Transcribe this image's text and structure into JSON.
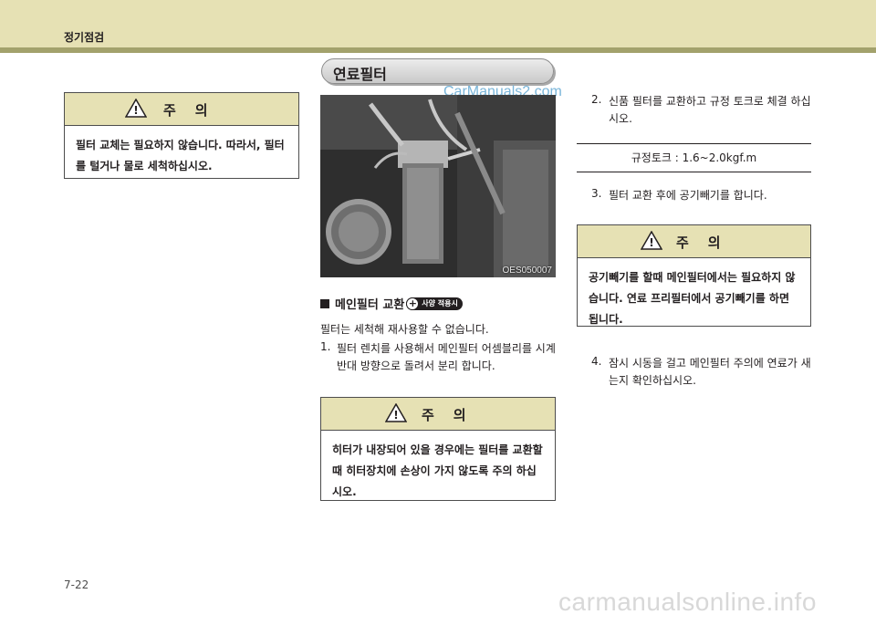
{
  "header": {
    "title": "정기점검"
  },
  "caution_label": "주    의",
  "left_caution": {
    "body": "필터 교체는 필요하지 않습니다. 따라서, 필터를 털거나 물로 세척하십시오."
  },
  "section": {
    "title": "연료필터"
  },
  "watermark": "CarManuals2.com",
  "photo": {
    "code": "OES050007"
  },
  "subsection": {
    "title": "메인필터 교환",
    "badge": "사양 적용시"
  },
  "middle": {
    "intro": "필터는 세척해 재사용할 수 없습니다.",
    "step1_num": "1.",
    "step1_text": "필터 렌치를 사용해서 메인필터 어셈블리를 시계 반대 방향으로 돌려서 분리 합니다."
  },
  "middle_caution": {
    "body": "히터가 내장되어 있을 경우에는 필터를 교환할 때 히터장치에 손상이 가지 않도록 주의 하십시오."
  },
  "right": {
    "step2_num": "2.",
    "step2_text": "신품 필터를 교환하고 규정 토크로 체결 하십시오.",
    "spec": "규정토크 : 1.6~2.0kgf.m",
    "step3_num": "3.",
    "step3_text": "필터 교환 후에 공기빼기를 합니다.",
    "step4_num": "4.",
    "step4_text": "잠시 시동을 걸고 메인필터 주의에 연료가 새는지 확인하십시오."
  },
  "right_caution": {
    "body": "공기빼기를 할때 메인필터에서는 필요하지 않습니다. 연료 프리필터에서 공기빼기를 하면 됩니다."
  },
  "page_number": "7-22",
  "footer_watermark": "carmanualsonline.info"
}
